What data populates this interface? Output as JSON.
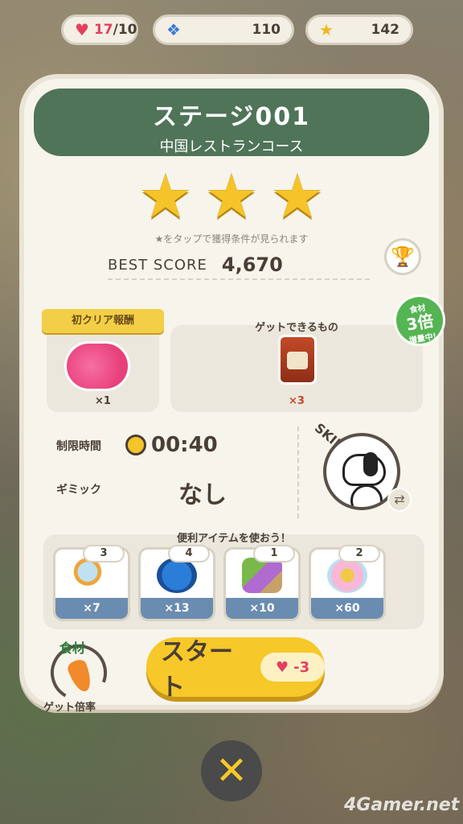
{
  "status": {
    "hearts_current": "17",
    "hearts_max": "/10",
    "paws": "110",
    "stars": "142"
  },
  "stage": {
    "title": "ステージ001",
    "subtitle": "中国レストランコース",
    "star_hint": "★をタップで獲得条件が見られます",
    "best_label": "BEST SCORE",
    "best_value": "4,670"
  },
  "reward": {
    "banner": "初クリア報酬",
    "count": "×1"
  },
  "obtainable": {
    "label": "ゲットできるもの",
    "count": "×3",
    "badge_top": "食材",
    "badge_mid": "3倍",
    "badge_bottom": "増量中!"
  },
  "info": {
    "time_label": "制限時間",
    "time_value": "00:40",
    "gimmick_label": "ギミック",
    "gimmick_value": "なし",
    "skill_label": "SKILL"
  },
  "items": {
    "title": "便利アイテムを使おう！",
    "list": [
      {
        "owned": "3",
        "cost": "×7"
      },
      {
        "owned": "4",
        "cost": "×13"
      },
      {
        "owned": "1",
        "cost": "×10"
      },
      {
        "owned": "2",
        "cost": "×60"
      }
    ]
  },
  "bottom": {
    "rate_tag": "食材",
    "rate_label": "ゲット倍率",
    "start_label": "スタート",
    "start_cost": "-3"
  },
  "watermark": "4Gamer.net",
  "colors": {
    "header_green": "#4f7458",
    "start_yellow": "#f6c829",
    "heart_red": "#e4405f"
  }
}
